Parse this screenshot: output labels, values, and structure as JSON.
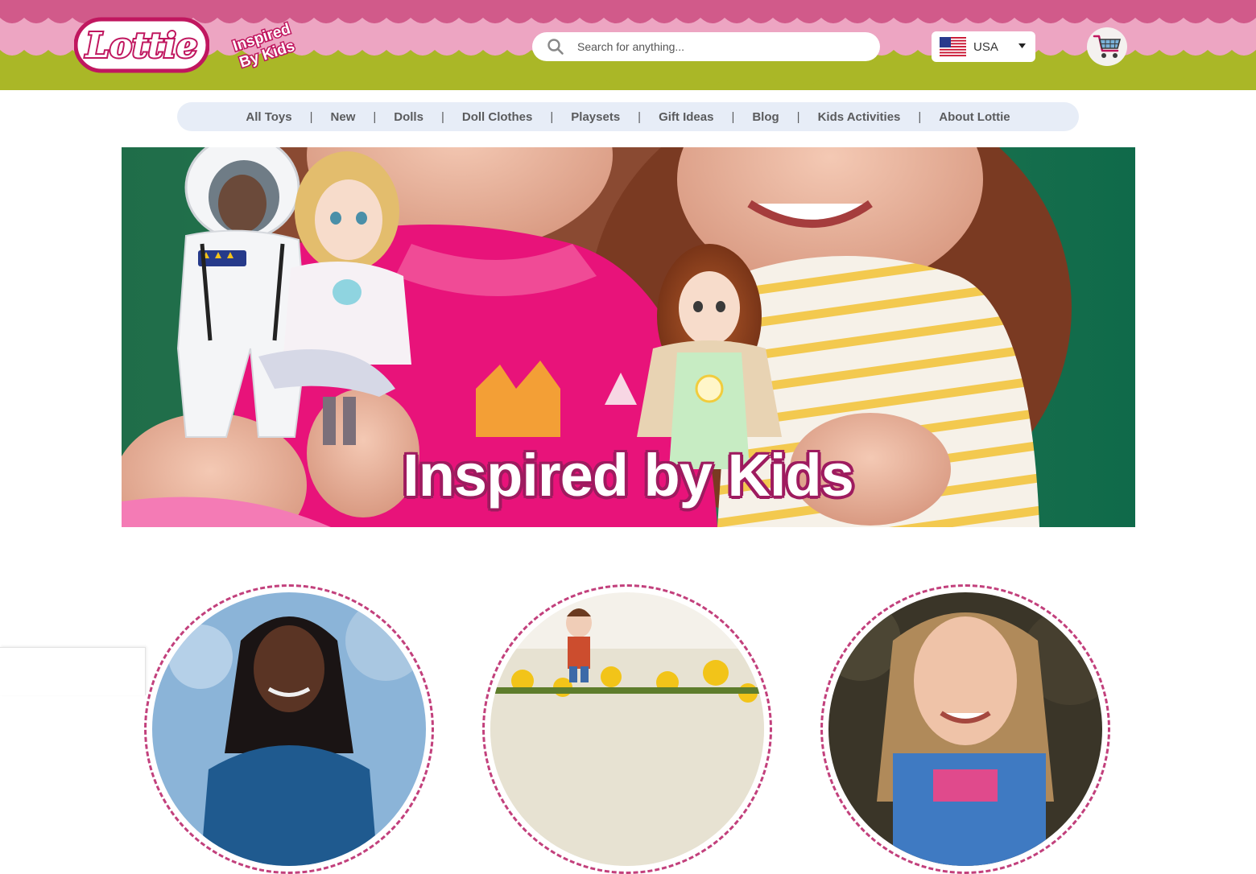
{
  "brand": {
    "logo_text": "Lottie",
    "tagline_line1": "Inspired",
    "tagline_line2": "By Kids"
  },
  "search": {
    "placeholder": "Search for anything..."
  },
  "country_selector": {
    "selected": "USA",
    "flag_icon": "us-flag-icon"
  },
  "cart": {
    "icon": "shopping-cart-icon"
  },
  "nav": {
    "items": [
      {
        "label": "All Toys"
      },
      {
        "label": "New"
      },
      {
        "label": "Dolls"
      },
      {
        "label": "Doll Clothes"
      },
      {
        "label": "Playsets"
      },
      {
        "label": "Gift Ideas"
      },
      {
        "label": "Blog"
      },
      {
        "label": "Kids Activities"
      },
      {
        "label": "About Lottie"
      }
    ],
    "separator": "|"
  },
  "hero": {
    "title": "Inspired by Kids"
  },
  "colors": {
    "header_pink": "#d15a8a",
    "header_light_pink": "#eda5c2",
    "header_lime": "#aab727",
    "brand_magenta": "#c0175f",
    "nav_bg": "#e7edf7"
  }
}
